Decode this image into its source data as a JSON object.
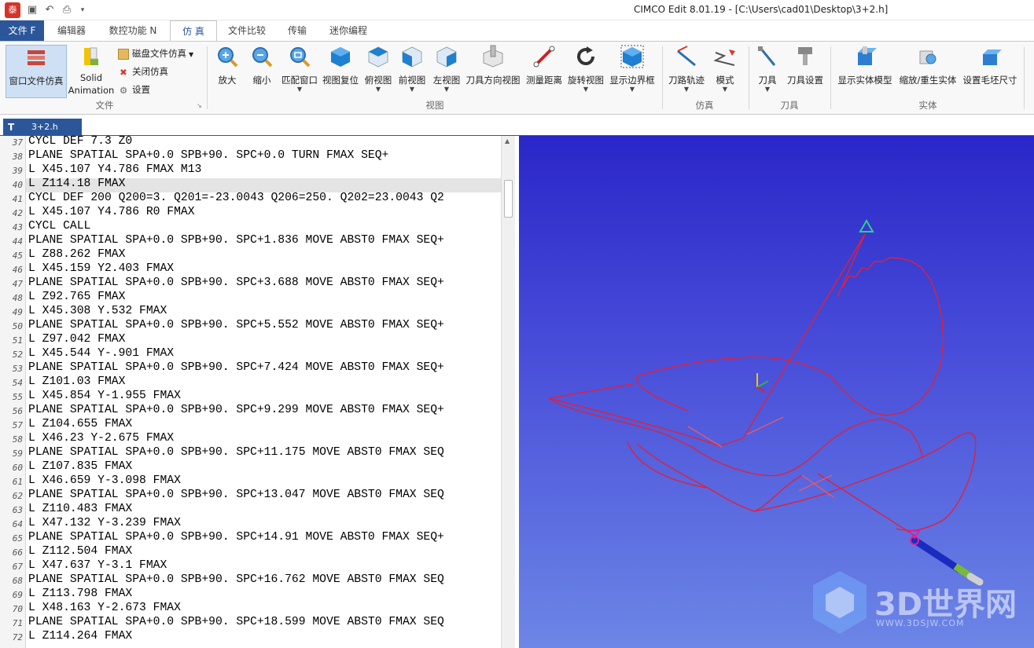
{
  "app": {
    "logo_char": "泰",
    "title": "CIMCO Edit 8.01.19 - [C:\\Users\\cad01\\Desktop\\3+2.h]"
  },
  "tabs": [
    "文件 F",
    "编辑器",
    "数控功能 N",
    "仿 真",
    "文件比较",
    "传输",
    "迷你编程"
  ],
  "ribbon": {
    "file_group": {
      "big1": "窗口文件仿真",
      "big2_line1": "Solid",
      "big2_line2": "Animation",
      "small1": "磁盘文件仿真",
      "small2": "关闭仿真",
      "small3": "设置",
      "label": "文件"
    },
    "view_group": {
      "buttons": [
        "放大",
        "缩小",
        "匹配窗口",
        "视图复位",
        "俯视图",
        "前视图",
        "左视图",
        "刀具方向视图",
        "测量距离",
        "旋转视图",
        "显示边界框"
      ],
      "label": "视图"
    },
    "sim_group": {
      "buttons": [
        "刀路轨迹",
        "模式"
      ],
      "label": "仿真"
    },
    "tool_group": {
      "buttons": [
        "刀具",
        "刀具设置"
      ],
      "label": "刀具"
    },
    "solid_group": {
      "buttons": [
        "显示实体模型",
        "缩放/重生实体",
        "设置毛坯尺寸"
      ],
      "label": "实体"
    }
  },
  "doc_tab": {
    "label": "3+2.h",
    "icon": "T"
  },
  "editor": {
    "highlight_line": 40,
    "lines": [
      {
        "n": "37",
        "t": "CYCL DEF 7.3 Z0"
      },
      {
        "n": "38",
        "t": "PLANE SPATIAL SPA+0.0 SPB+90. SPC+0.0 TURN FMAX SEQ+"
      },
      {
        "n": "39",
        "t": "L X45.107 Y4.786 FMAX M13"
      },
      {
        "n": "40",
        "t": "L Z114.18 FMAX"
      },
      {
        "n": "41",
        "t": "CYCL DEF 200 Q200=3. Q201=-23.0043 Q206=250. Q202=23.0043 Q2"
      },
      {
        "n": "42",
        "t": "L X45.107 Y4.786 R0 FMAX"
      },
      {
        "n": "43",
        "t": "CYCL CALL"
      },
      {
        "n": "44",
        "t": "PLANE SPATIAL SPA+0.0 SPB+90. SPC+1.836 MOVE ABST0 FMAX SEQ+"
      },
      {
        "n": "45",
        "t": "L Z88.262 FMAX"
      },
      {
        "n": "46",
        "t": "L X45.159 Y2.403 FMAX"
      },
      {
        "n": "47",
        "t": "PLANE SPATIAL SPA+0.0 SPB+90. SPC+3.688 MOVE ABST0 FMAX SEQ+"
      },
      {
        "n": "48",
        "t": "L Z92.765 FMAX"
      },
      {
        "n": "49",
        "t": "L X45.308 Y.532 FMAX"
      },
      {
        "n": "50",
        "t": "PLANE SPATIAL SPA+0.0 SPB+90. SPC+5.552 MOVE ABST0 FMAX SEQ+"
      },
      {
        "n": "51",
        "t": "L Z97.042 FMAX"
      },
      {
        "n": "52",
        "t": "L X45.544 Y-.901 FMAX"
      },
      {
        "n": "53",
        "t": "PLANE SPATIAL SPA+0.0 SPB+90. SPC+7.424 MOVE ABST0 FMAX SEQ+"
      },
      {
        "n": "54",
        "t": "L Z101.03 FMAX"
      },
      {
        "n": "55",
        "t": "L X45.854 Y-1.955 FMAX"
      },
      {
        "n": "56",
        "t": "PLANE SPATIAL SPA+0.0 SPB+90. SPC+9.299 MOVE ABST0 FMAX SEQ+"
      },
      {
        "n": "57",
        "t": "L Z104.655 FMAX"
      },
      {
        "n": "58",
        "t": "L X46.23 Y-2.675 FMAX"
      },
      {
        "n": "59",
        "t": "PLANE SPATIAL SPA+0.0 SPB+90. SPC+11.175 MOVE ABST0 FMAX SEQ"
      },
      {
        "n": "60",
        "t": "L Z107.835 FMAX"
      },
      {
        "n": "61",
        "t": "L X46.659 Y-3.098 FMAX"
      },
      {
        "n": "62",
        "t": "PLANE SPATIAL SPA+0.0 SPB+90. SPC+13.047 MOVE ABST0 FMAX SEQ"
      },
      {
        "n": "63",
        "t": "L Z110.483 FMAX"
      },
      {
        "n": "64",
        "t": "L X47.132 Y-3.239 FMAX"
      },
      {
        "n": "65",
        "t": "PLANE SPATIAL SPA+0.0 SPB+90. SPC+14.91 MOVE ABST0 FMAX SEQ+"
      },
      {
        "n": "66",
        "t": "L Z112.504 FMAX"
      },
      {
        "n": "67",
        "t": "L X47.637 Y-3.1 FMAX"
      },
      {
        "n": "68",
        "t": "PLANE SPATIAL SPA+0.0 SPB+90. SPC+16.762 MOVE ABST0 FMAX SEQ"
      },
      {
        "n": "69",
        "t": "L Z113.798 FMAX"
      },
      {
        "n": "70",
        "t": "L X48.163 Y-2.673 FMAX"
      },
      {
        "n": "71",
        "t": "PLANE SPATIAL SPA+0.0 SPB+90. SPC+18.599 MOVE ABST0 FMAX SEQ"
      },
      {
        "n": "72",
        "t": "L Z114.264 FMAX"
      }
    ]
  },
  "watermark": {
    "big": "3D世界网",
    "small": "WWW.3DSJW.COM"
  },
  "colors": {
    "accent": "#2b579a",
    "toolpath": "#e0203c",
    "viewport_top": "#2a26c8",
    "viewport_bottom": "#6c86e6"
  }
}
